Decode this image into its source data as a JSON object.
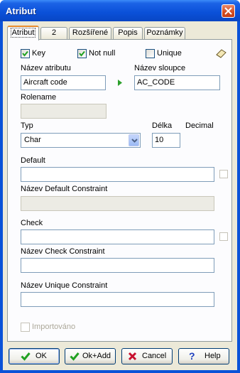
{
  "window": {
    "title": "Atribut"
  },
  "tabs": [
    {
      "label": "Atribut",
      "active": true
    },
    {
      "label": "2"
    },
    {
      "label": "Rozšířené"
    },
    {
      "label": "Popis"
    },
    {
      "label": "Poznámky"
    }
  ],
  "checks": {
    "key": {
      "label": "Key",
      "checked": true
    },
    "not_null": {
      "label": "Not null",
      "checked": true
    },
    "unique": {
      "label": "Unique",
      "checked": false
    }
  },
  "fields": {
    "attr_name": {
      "label": "Název atributu",
      "value": "Aircraft code"
    },
    "column_name": {
      "label": "Název sloupce",
      "value": "AC_CODE"
    },
    "rolename": {
      "label": "Rolename",
      "value": ""
    },
    "type": {
      "label": "Typ",
      "value": "Char"
    },
    "length": {
      "label": "Délka",
      "value": "10"
    },
    "decimal": {
      "label": "Decimal"
    },
    "default": {
      "label": "Default",
      "value": ""
    },
    "default_constraint": {
      "label": "Název Default Constraint",
      "value": ""
    },
    "check": {
      "label": "Check",
      "value": ""
    },
    "check_constraint": {
      "label": "Název Check Constraint",
      "value": ""
    },
    "unique_constraint": {
      "label": "Název Unique Constraint",
      "value": ""
    },
    "imported": {
      "label": "Importováno",
      "checked": false
    }
  },
  "buttons": {
    "ok": "OK",
    "ok_add": "Ok+Add",
    "cancel": "Cancel",
    "help": "Help"
  },
  "colors": {
    "title_bar": "#0a50d8",
    "dialog_bg": "#ece9d8",
    "check_green": "#21a121",
    "arrow_green": "#2ca02c",
    "cancel_red": "#c8102e",
    "help_blue": "#1d3fbf"
  }
}
